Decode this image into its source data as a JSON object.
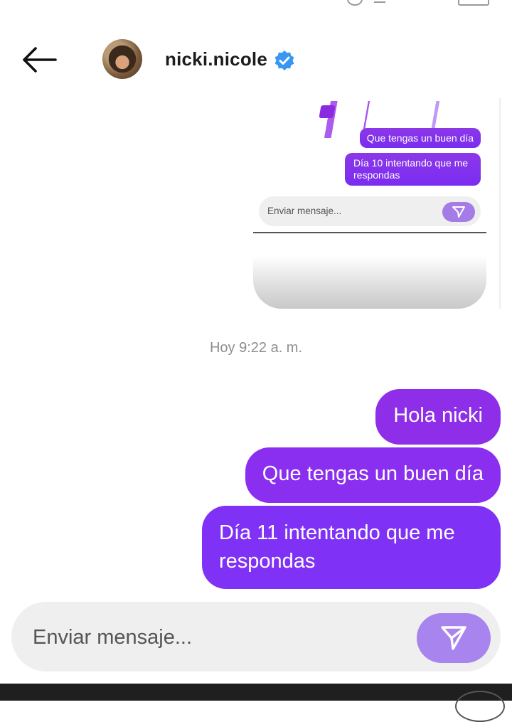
{
  "header": {
    "username": "nicki.nicole",
    "verified_icon": "verified-badge-icon",
    "back_icon": "arrow-left-icon",
    "avatar_icon": "profile-avatar"
  },
  "embedded_image": {
    "messages": [
      "Que tengas un buen día",
      "Día 10 intentando que me respondas"
    ],
    "input_placeholder": "Enviar mensaje...",
    "send_icon": "send-icon"
  },
  "conversation": {
    "timestamp": "Hoy 9:22 a. m.",
    "messages": [
      "Hola nicki",
      "Que tengas un buen día",
      "Día 11 intentando que me respondas"
    ]
  },
  "composer": {
    "placeholder": "Enviar mensaje...",
    "send_icon": "send-icon"
  },
  "colors": {
    "bubble": "#8a2ef0",
    "send_button": "#a884ee",
    "composer_bg": "#efefef",
    "verified": "#3897f0"
  }
}
